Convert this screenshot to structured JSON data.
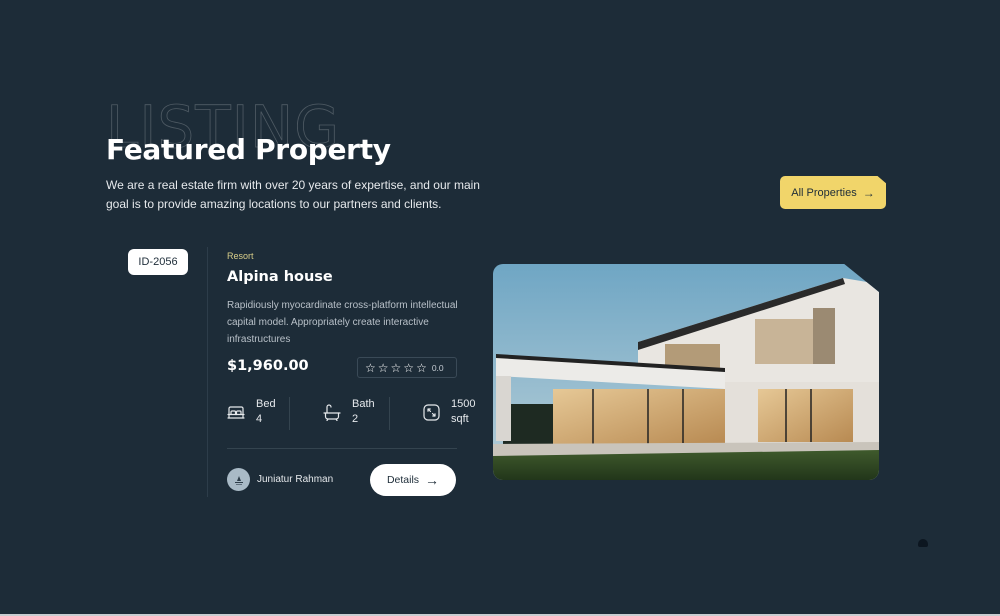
{
  "section": {
    "background_word": "LISTING",
    "title": "Featured Property",
    "subtitle": "We are a real estate firm with over 20 years of expertise, and our main goal is to provide amazing locations to our partners and clients.",
    "all_button": {
      "label": "All Properties",
      "icon": "arrow-right-icon"
    }
  },
  "property": {
    "id": "ID-2056",
    "category": "Resort",
    "title": "Alpina house",
    "description": "Rapidiously myocardinate cross-platform intellectual capital model. Appropriately create interactive infrastructures",
    "price": "$1,960.00",
    "rating": {
      "stars_total": 5,
      "stars_filled": 0,
      "score": "0.0"
    },
    "features": [
      {
        "icon": "bed-icon",
        "label": "Bed",
        "value": "4"
      },
      {
        "icon": "bathtub-icon",
        "label": "Bath",
        "value": "2"
      },
      {
        "icon": "area-expand-icon",
        "label": "1500",
        "value": "sqft"
      }
    ],
    "agent": {
      "name": "Juniatur Rahman",
      "avatar": "avatar"
    },
    "details_button": {
      "label": "Details",
      "icon": "arrow-right-icon"
    },
    "image": {
      "alt": "Modern two-storey white villa with glass walls and lawn"
    }
  },
  "colors": {
    "background": "#1d2c38",
    "accent": "#f1d56a",
    "category": "#d9cf8a",
    "text": "#ffffff",
    "muted": "#b8c0c8"
  }
}
